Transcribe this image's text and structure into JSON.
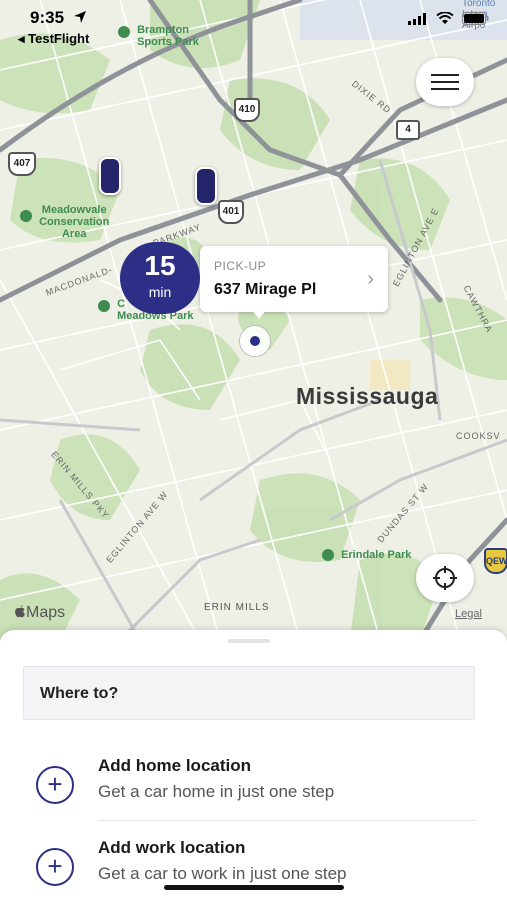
{
  "status_bar": {
    "time": "9:35",
    "back_app": "◂ TestFlight"
  },
  "map": {
    "parks": [
      {
        "id": "brampton",
        "text": "Brampton\nSports Park"
      },
      {
        "id": "meadowvale",
        "text": "Meadowvale\nConservation\nArea"
      },
      {
        "id": "meadows",
        "text": "C\nMeadows Park"
      },
      {
        "id": "erindale",
        "text": "Erindale Park"
      }
    ],
    "streets": {
      "dixie": "DIXIE RD",
      "parkway": "PARKWAY",
      "macdonald": "MACDONALD-",
      "eglinton_e": "EGLINTON AVE E",
      "cawthra": "CAWTHRA",
      "cooksville": "COOKSV",
      "dundas": "DUNDAS ST W",
      "erin_mills": "ERIN MILLS PKY",
      "eglinton_w": "EGLINTON AVE W",
      "erin_mills_area": "ERIN MILLS",
      "airport": "Toronto\nIntern\nAirpo"
    },
    "highways": {
      "h410": "410",
      "h4": "4",
      "h407": "407",
      "h401": "401",
      "qew": "QEW"
    },
    "city": "Mississauga",
    "attribution": "Maps",
    "legal": "Legal"
  },
  "pickup": {
    "eta_value": "15",
    "eta_unit": "min",
    "label": "PICK-UP",
    "address": "637 Mirage Pl"
  },
  "sheet": {
    "search_placeholder": "Where to?",
    "shortcuts": [
      {
        "title": "Add home location",
        "subtitle": "Get a car home in just one step"
      },
      {
        "title": "Add work location",
        "subtitle": "Get a car to work in just one step"
      }
    ]
  },
  "colors": {
    "brand": "#2d2f86",
    "map_bg": "#eef0e6",
    "park": "#c8e0b4",
    "highway": "#8f9399"
  },
  "icons": [
    "location-arrow-icon",
    "signal-icon",
    "wifi-icon",
    "battery-icon",
    "menu-icon",
    "chevron-right-icon",
    "crosshair-icon",
    "apple-logo-icon",
    "plus-icon",
    "car-icon",
    "park-icon",
    "highway-shield-icon"
  ]
}
